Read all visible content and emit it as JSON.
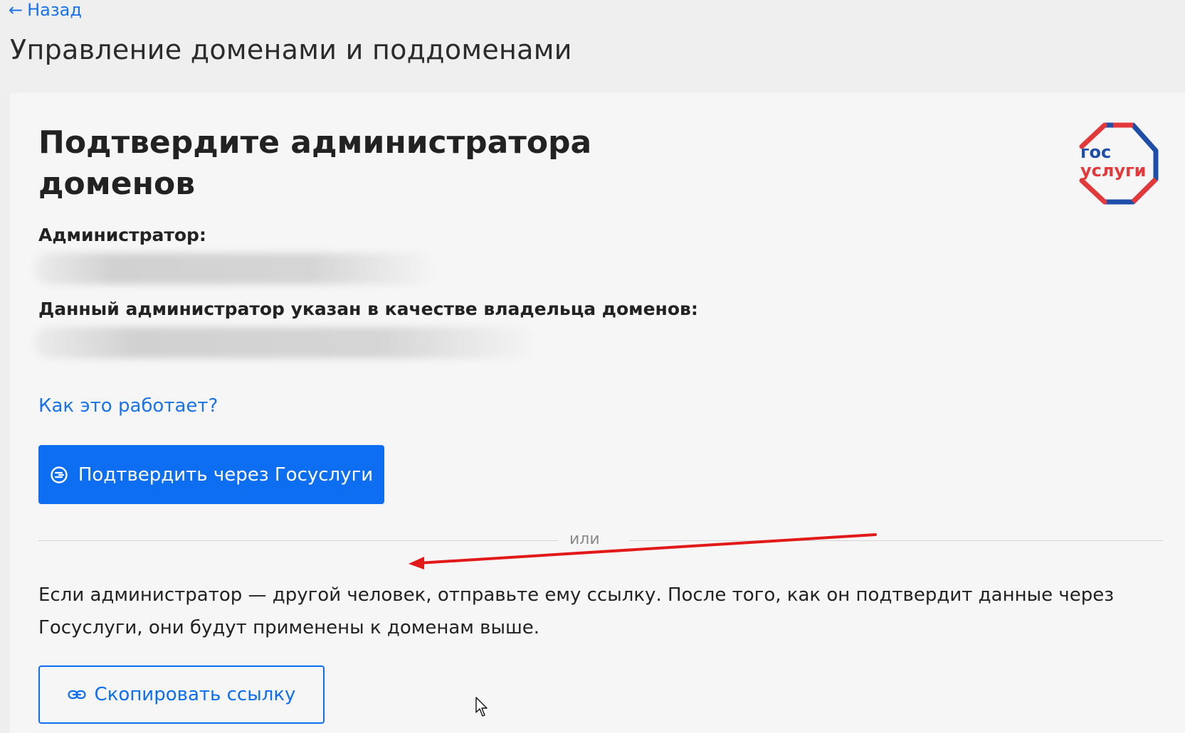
{
  "nav": {
    "back_label": "Назад"
  },
  "page": {
    "title": "Управление доменами и поддоменами"
  },
  "card": {
    "heading": "Подтвердите администратора доменов",
    "logo_line1": "гос",
    "logo_line2": "услуги",
    "admin_label": "Администратор:",
    "owner_label": "Данный администратор указан в качестве владельца доменов:",
    "help_link": "Как это работает?",
    "confirm_button": "Подтвердить через Госуслуги",
    "divider_text": "или",
    "info_text": "Если администратор — другой человек, отправьте ему ссылку. После того, как он подтвердит данные через Госуслуги, они будут применены к доменам выше.",
    "copy_button": "Скопировать ссылку"
  },
  "colors": {
    "accent": "#0d6ef2",
    "link": "#1a73e8",
    "logo_blue": "#1f4ea8",
    "logo_red": "#e3393a",
    "annotation_red": "#e11919",
    "background": "#efeff0",
    "card": "#f6f6f6"
  },
  "icons": {
    "back": "arrow-left-icon",
    "confirm": "gosuslugi-login-icon",
    "copy": "link-icon"
  }
}
